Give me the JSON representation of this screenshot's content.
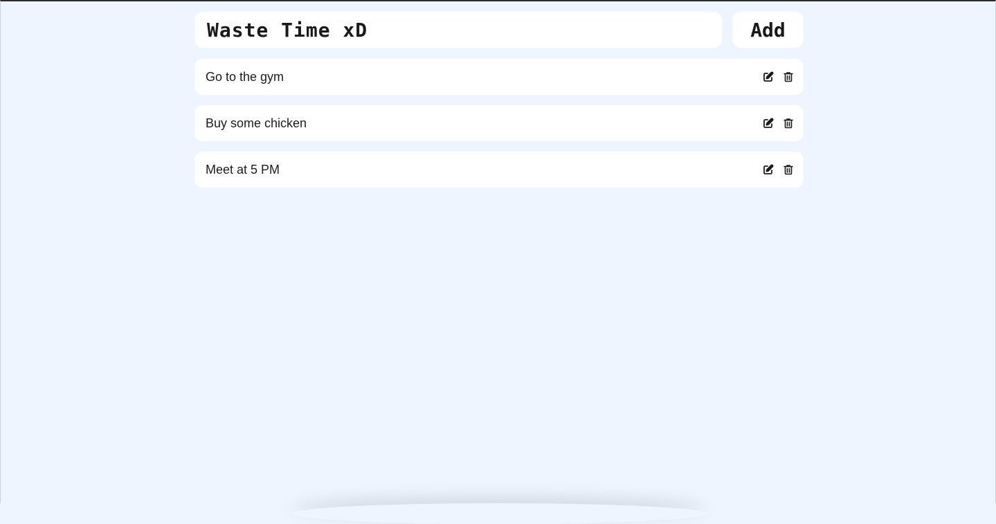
{
  "input": {
    "value": "Waste Time xD",
    "placeholder": ""
  },
  "add_button": {
    "label": "Add"
  },
  "tasks": [
    {
      "text": "Go to the gym",
      "edit_icon": "edit-icon",
      "delete_icon": "trash-icon"
    },
    {
      "text": "Buy some chicken",
      "edit_icon": "edit-icon",
      "delete_icon": "trash-icon"
    },
    {
      "text": "Meet at 5 PM",
      "edit_icon": "edit-icon",
      "delete_icon": "trash-icon"
    }
  ],
  "colors": {
    "background": "#eef5ff",
    "card": "#ffffff",
    "text": "#1b1b1b"
  }
}
